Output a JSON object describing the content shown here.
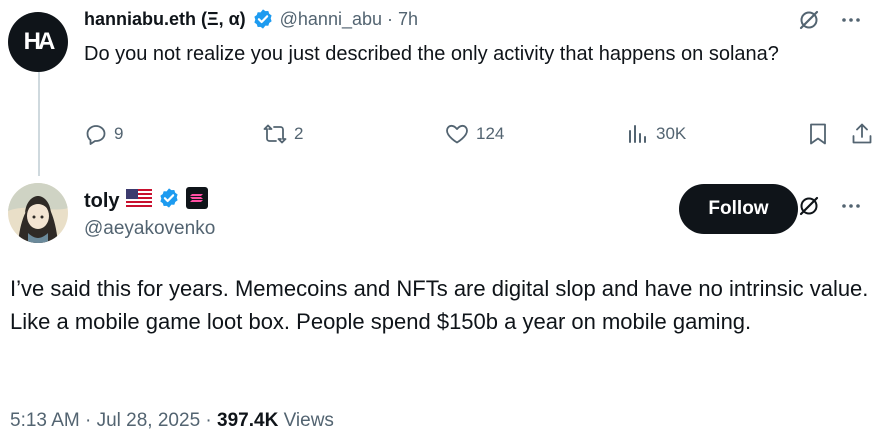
{
  "reply": {
    "avatar_text": "HA",
    "name": "hanniabu.eth (Ξ, α)",
    "handle": "@hanni_abu",
    "separator": "·",
    "time": "7h",
    "text": "Do you not realize you just described the only activity that happens on solana?",
    "actions": {
      "replies": "9",
      "reposts": "2",
      "likes": "124",
      "views": "30K"
    },
    "icons": [
      "grok-icon",
      "more-icon",
      "reply-icon",
      "repost-icon",
      "like-icon",
      "views-icon",
      "bookmark-icon",
      "share-icon",
      "verified-icon"
    ]
  },
  "tweet": {
    "author_name": "toly",
    "author_handle": "@aeyakovenko",
    "flag_icon": "us-flag-icon",
    "org_badge_icon": "solana-badge-icon",
    "follow_label": "Follow",
    "text": "I’ve said this for years.  Memecoins and NFTs are digital slop and have no intrinsic value.  Like a mobile game loot box.  People spend $150b a year on mobile gaming.",
    "time": "5:13 AM",
    "separator": "·",
    "date": "Jul 28, 2025",
    "separator2": "·",
    "views_count": "397.4K",
    "views_label": "Views"
  },
  "colors": {
    "text": "#0f1419",
    "muted": "#536471",
    "verified": "#1d9bf0",
    "thread_line": "#cfd9de",
    "follow_bg": "#0f1419"
  }
}
